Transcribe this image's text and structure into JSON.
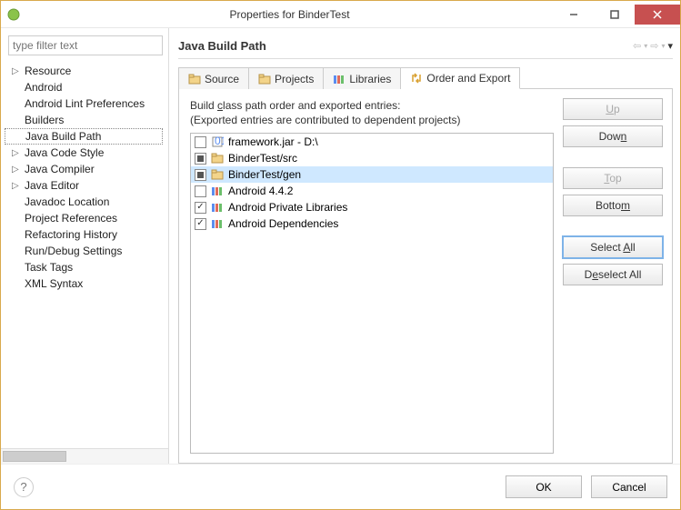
{
  "window": {
    "title": "Properties for BinderTest"
  },
  "filter": {
    "placeholder": "type filter text"
  },
  "tree": {
    "items": [
      {
        "label": "Resource",
        "expandable": true
      },
      {
        "label": "Android"
      },
      {
        "label": "Android Lint Preferences"
      },
      {
        "label": "Builders"
      },
      {
        "label": "Java Build Path",
        "selected": true
      },
      {
        "label": "Java Code Style",
        "expandable": true
      },
      {
        "label": "Java Compiler",
        "expandable": true
      },
      {
        "label": "Java Editor",
        "expandable": true
      },
      {
        "label": "Javadoc Location"
      },
      {
        "label": "Project References"
      },
      {
        "label": "Refactoring History"
      },
      {
        "label": "Run/Debug Settings"
      },
      {
        "label": "Task Tags"
      },
      {
        "label": "XML Syntax"
      }
    ]
  },
  "section": {
    "title": "Java Build Path"
  },
  "tabs": {
    "source": "Source",
    "projects": "Projects",
    "libraries": "Libraries",
    "order": "Order and Export"
  },
  "order": {
    "line1": "Build class path order and exported entries:",
    "line2": "(Exported entries are contributed to dependent projects)",
    "entries": [
      {
        "checked": false,
        "icon": "jar",
        "label": "framework.jar - D:\\"
      },
      {
        "checked": true,
        "icon": "folder",
        "label": "BinderTest/src"
      },
      {
        "checked": true,
        "icon": "folder",
        "label": "BinderTest/gen",
        "selected": true
      },
      {
        "checked": false,
        "icon": "library",
        "label": "Android 4.4.2"
      },
      {
        "checked": true,
        "icon": "library",
        "label": "Android Private Libraries"
      },
      {
        "checked": true,
        "icon": "library",
        "label": "Android Dependencies"
      }
    ]
  },
  "buttons": {
    "up": "Up",
    "down": "Down",
    "top": "Top",
    "bottom": "Bottom",
    "selectall": "Select All",
    "deselectall": "Deselect All",
    "ok": "OK",
    "cancel": "Cancel"
  }
}
